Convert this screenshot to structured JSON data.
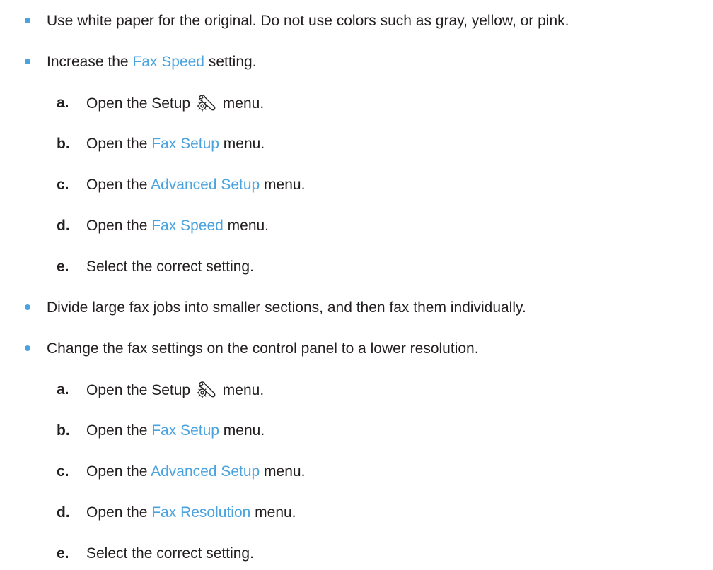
{
  "colors": {
    "bullet": "#4aa3df",
    "link": "#4aa3df",
    "text": "#231f20"
  },
  "icons": {
    "setup": "setup-wrench-gear-icon"
  },
  "items": [
    {
      "type": "bullet",
      "parts": [
        {
          "text": "Use white paper for the original. Do not use colors such as gray, yellow, or pink.",
          "link": false
        }
      ]
    },
    {
      "type": "bullet",
      "parts": [
        {
          "text": "Increase the ",
          "link": false
        },
        {
          "text": "Fax Speed",
          "link": true
        },
        {
          "text": " setting.",
          "link": false
        }
      ]
    },
    {
      "type": "step",
      "letter": "a.",
      "parts": [
        {
          "text": "Open the Setup ",
          "link": false
        },
        {
          "icon": "setup"
        },
        {
          "text": " menu.",
          "link": false
        }
      ]
    },
    {
      "type": "step",
      "letter": "b.",
      "parts": [
        {
          "text": "Open the ",
          "link": false
        },
        {
          "text": "Fax Setup",
          "link": true
        },
        {
          "text": " menu.",
          "link": false
        }
      ]
    },
    {
      "type": "step",
      "letter": "c.",
      "parts": [
        {
          "text": "Open the ",
          "link": false
        },
        {
          "text": "Advanced Setup",
          "link": true
        },
        {
          "text": " menu.",
          "link": false
        }
      ]
    },
    {
      "type": "step",
      "letter": "d.",
      "parts": [
        {
          "text": "Open the ",
          "link": false
        },
        {
          "text": "Fax Speed",
          "link": true
        },
        {
          "text": " menu.",
          "link": false
        }
      ]
    },
    {
      "type": "step",
      "letter": "e.",
      "parts": [
        {
          "text": "Select the correct setting.",
          "link": false
        }
      ]
    },
    {
      "type": "bullet",
      "parts": [
        {
          "text": "Divide large fax jobs into smaller sections, and then fax them individually.",
          "link": false
        }
      ]
    },
    {
      "type": "bullet",
      "parts": [
        {
          "text": "Change the fax settings on the control panel to a lower resolution.",
          "link": false
        }
      ]
    },
    {
      "type": "step",
      "letter": "a.",
      "parts": [
        {
          "text": "Open the Setup ",
          "link": false
        },
        {
          "icon": "setup"
        },
        {
          "text": " menu.",
          "link": false
        }
      ]
    },
    {
      "type": "step",
      "letter": "b.",
      "parts": [
        {
          "text": "Open the ",
          "link": false
        },
        {
          "text": "Fax Setup",
          "link": true
        },
        {
          "text": " menu.",
          "link": false
        }
      ]
    },
    {
      "type": "step",
      "letter": "c.",
      "parts": [
        {
          "text": "Open the ",
          "link": false
        },
        {
          "text": "Advanced Setup",
          "link": true
        },
        {
          "text": " menu.",
          "link": false
        }
      ]
    },
    {
      "type": "step",
      "letter": "d.",
      "parts": [
        {
          "text": "Open the ",
          "link": false
        },
        {
          "text": "Fax Resolution",
          "link": true
        },
        {
          "text": " menu.",
          "link": false
        }
      ]
    },
    {
      "type": "step",
      "letter": "e.",
      "parts": [
        {
          "text": "Select the correct setting.",
          "link": false
        }
      ]
    }
  ]
}
